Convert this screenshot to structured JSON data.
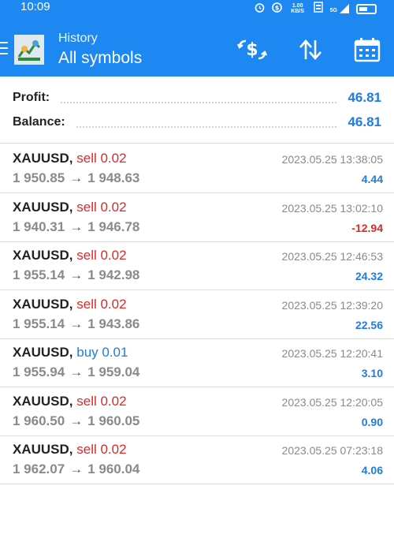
{
  "status_bar": {
    "time": "10:09",
    "icons": [
      "alarm-icon",
      "vpn-icon",
      "data-speed-icon",
      "volte-icon",
      "signal-icon",
      "battery-icon"
    ],
    "data_speed": "1.00 KB/S",
    "network": "5G"
  },
  "header": {
    "subtitle": "History",
    "title": "All symbols",
    "toolbar_icons": [
      "currency-exchange-icon",
      "sort-icon",
      "calendar-icon"
    ]
  },
  "summary": {
    "profit_label": "Profit:",
    "profit_value": "46.81",
    "balance_label": "Balance:",
    "balance_value": "46.81"
  },
  "deals": [
    {
      "symbol": "XAUUSD,",
      "type": "sell 0.02",
      "side": "sell",
      "open": "1 950.85",
      "arrow": "→",
      "close": "1 948.63",
      "time": "2023.05.25 13:38:05",
      "profit": "4.44"
    },
    {
      "symbol": "XAUUSD,",
      "type": "sell 0.02",
      "side": "sell",
      "open": "1 940.31",
      "arrow": "→",
      "close": "1 946.78",
      "time": "2023.05.25 13:02:10",
      "profit": "-12.94"
    },
    {
      "symbol": "XAUUSD,",
      "type": "sell 0.02",
      "side": "sell",
      "open": "1 955.14",
      "arrow": "→",
      "close": "1 942.98",
      "time": "2023.05.25 12:46:53",
      "profit": "24.32"
    },
    {
      "symbol": "XAUUSD,",
      "type": "sell 0.02",
      "side": "sell",
      "open": "1 955.14",
      "arrow": "→",
      "close": "1 943.86",
      "time": "2023.05.25 12:39:20",
      "profit": "22.56"
    },
    {
      "symbol": "XAUUSD,",
      "type": "buy 0.01",
      "side": "buy",
      "open": "1 955.94",
      "arrow": "→",
      "close": "1 959.04",
      "time": "2023.05.25 12:20:41",
      "profit": "3.10"
    },
    {
      "symbol": "XAUUSD,",
      "type": "sell 0.02",
      "side": "sell",
      "open": "1 960.50",
      "arrow": "→",
      "close": "1 960.05",
      "time": "2023.05.25 12:20:05",
      "profit": "0.90"
    },
    {
      "symbol": "XAUUSD,",
      "type": "sell 0.02",
      "side": "sell",
      "open": "1 962.07",
      "arrow": "→",
      "close": "1 960.04",
      "time": "2023.05.25 07:23:18",
      "profit": "4.06"
    }
  ],
  "colors": {
    "appbar": "#1e88f2",
    "sell": "#e02727",
    "buy": "#1f7be6",
    "profit_positive": "#1f7be6",
    "profit_negative": "#e02727"
  }
}
